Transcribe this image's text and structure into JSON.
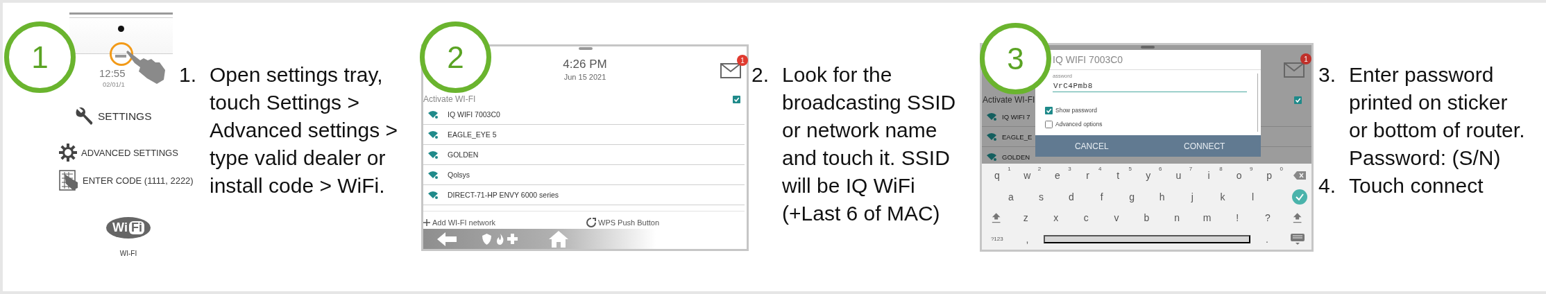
{
  "steps": [
    {
      "number": "1",
      "kind": "tray",
      "screen": {
        "time": "12:55",
        "date": "02/01/1",
        "menu": [
          {
            "kind": "settings",
            "label": "SETTINGS"
          },
          {
            "kind": "advanced",
            "label": "ADVANCED SETTINGS"
          },
          {
            "kind": "code",
            "label": "ENTER CODE (1111, 2222)"
          },
          {
            "kind": "wifi",
            "label": "WI-FI",
            "logo_text": [
              "Wi",
              "Fi"
            ]
          }
        ]
      },
      "instructions": [
        {
          "marker": "1.",
          "lines": [
            "Open settings tray,",
            "touch Settings >",
            "Advanced settings >",
            "type valid dealer or",
            "install code > WiFi."
          ]
        }
      ]
    },
    {
      "number": "2",
      "kind": "network_list",
      "screen": {
        "time": "4:26 PM",
        "date": "Jun 15 2021",
        "unread": "1",
        "wifi_toggle": {
          "label": "Activate WI-FI",
          "checked": true
        },
        "networks": [
          "IQ WIFI 7003C0",
          "EAGLE_EYE 5",
          "GOLDEN",
          "Qolsys",
          "DIRECT-71-HP ENVY 6000 series"
        ],
        "add_network": "Add WI-FI network",
        "wps": "WPS Push Button"
      },
      "instructions": [
        {
          "marker": "2.",
          "lines": [
            "Look for the",
            "broadcasting SSID",
            "or network name",
            "and touch it. SSID",
            "will be IQ WiFi",
            "(+Last 6 of MAC)"
          ]
        }
      ]
    },
    {
      "number": "3",
      "kind": "password_dialog",
      "screen": {
        "unread": "1",
        "wifi_toggle": {
          "label": "Activate WI-FI",
          "checked": true
        },
        "networks": [
          "IQ WIFI 7",
          "EAGLE_E",
          "GOLDEN"
        ],
        "dialog": {
          "title": "IQ WIFI 7003C0",
          "password_label": "assword",
          "password": "VrC4Pmb8",
          "options": [
            {
              "label": "Show password",
              "checked": true
            },
            {
              "label": "Advanced options",
              "checked": false
            }
          ],
          "buttons": [
            "CANCEL",
            "CONNECT"
          ]
        },
        "keyboard": {
          "rows": [
            [
              {
                "kind": "char",
                "label": "q",
                "hint": "1"
              },
              {
                "kind": "char",
                "label": "w",
                "hint": "2"
              },
              {
                "kind": "char",
                "label": "e",
                "hint": "3"
              },
              {
                "kind": "char",
                "label": "r",
                "hint": "4"
              },
              {
                "kind": "char",
                "label": "t",
                "hint": "5"
              },
              {
                "kind": "char",
                "label": "y",
                "hint": "6"
              },
              {
                "kind": "char",
                "label": "u",
                "hint": "7"
              },
              {
                "kind": "char",
                "label": "i",
                "hint": "8"
              },
              {
                "kind": "char",
                "label": "o",
                "hint": "9"
              },
              {
                "kind": "char",
                "label": "p",
                "hint": "0"
              },
              {
                "kind": "backspace"
              }
            ],
            [
              {
                "kind": "char",
                "label": "a"
              },
              {
                "kind": "char",
                "label": "s"
              },
              {
                "kind": "char",
                "label": "d"
              },
              {
                "kind": "char",
                "label": "f"
              },
              {
                "kind": "char",
                "label": "g"
              },
              {
                "kind": "char",
                "label": "h"
              },
              {
                "kind": "char",
                "label": "j"
              },
              {
                "kind": "char",
                "label": "k"
              },
              {
                "kind": "char",
                "label": "l"
              },
              {
                "kind": "enter"
              }
            ],
            [
              {
                "kind": "shift"
              },
              {
                "kind": "char",
                "label": "z"
              },
              {
                "kind": "char",
                "label": "x"
              },
              {
                "kind": "char",
                "label": "c"
              },
              {
                "kind": "char",
                "label": "v"
              },
              {
                "kind": "char",
                "label": "b"
              },
              {
                "kind": "char",
                "label": "n"
              },
              {
                "kind": "char",
                "label": "m"
              },
              {
                "kind": "char",
                "label": "!"
              },
              {
                "kind": "char",
                "label": "?"
              },
              {
                "kind": "shift"
              }
            ],
            [
              {
                "kind": "mode",
                "label": "?123"
              },
              {
                "kind": "char",
                "label": ","
              },
              {
                "kind": "space"
              },
              {
                "kind": "char",
                "label": "."
              },
              {
                "kind": "hide"
              }
            ]
          ]
        }
      },
      "instructions": [
        {
          "marker": "3.",
          "lines": [
            "Enter password",
            "printed on sticker",
            "or bottom of router.",
            "Password: (S/N)"
          ]
        },
        {
          "marker": "4.",
          "lines": [
            "Touch connect"
          ]
        }
      ]
    }
  ]
}
